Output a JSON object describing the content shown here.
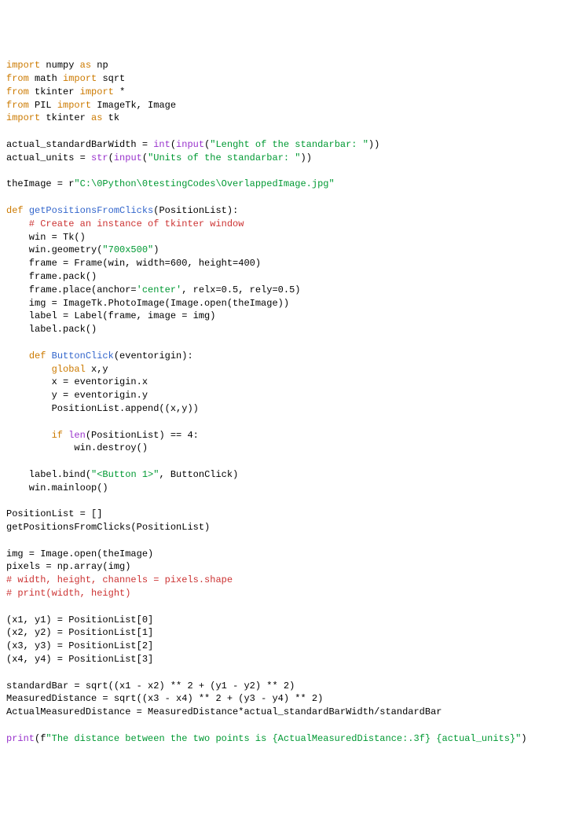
{
  "code": {
    "line1": {
      "kw1": "import",
      "sp1": " ",
      "mod": "numpy",
      "sp2": " ",
      "kw2": "as",
      "sp3": " ",
      "alias": "np"
    },
    "line2": {
      "kw1": "from",
      "sp1": " ",
      "mod": "math",
      "sp2": " ",
      "kw2": "import",
      "sp3": " ",
      "sym": "sqrt"
    },
    "line3": {
      "kw1": "from",
      "sp1": " ",
      "mod": "tkinter",
      "sp2": " ",
      "kw2": "import",
      "sp3": " ",
      "sym": "*"
    },
    "line4": {
      "kw1": "from",
      "sp1": " ",
      "mod": "PIL",
      "sp2": " ",
      "kw2": "import",
      "sp3": " ",
      "sym": "ImageTk, Image"
    },
    "line5": {
      "kw1": "import",
      "sp1": " ",
      "mod": "tkinter",
      "sp2": " ",
      "kw2": "as",
      "sp3": " ",
      "alias": "tk"
    },
    "line7a": "actual_standardBarWidth = ",
    "line7b": "int",
    "line7c": "(",
    "line7d": "input",
    "line7e": "(",
    "line7f": "\"Lenght of the standarbar: \"",
    "line7g": "))",
    "line8a": "actual_units = ",
    "line8b": "str",
    "line8c": "(",
    "line8d": "input",
    "line8e": "(",
    "line8f": "\"Units of the standarbar: \"",
    "line8g": "))",
    "line10a": "theImage = r",
    "line10b": "\"C:\\0Python\\0testingCodes\\OverlappedImage.jpg\"",
    "line12a": "def",
    "line12b": " ",
    "line12c": "getPositionsFromClicks",
    "line12d": "(PositionList):",
    "line13": "    # Create an instance of tkinter window",
    "line14": "    win = Tk()",
    "line15a": "    win.geometry(",
    "line15b": "\"700x500\"",
    "line15c": ")",
    "line16": "    frame = Frame(win, width=600, height=400)",
    "line17": "    frame.pack()",
    "line18a": "    frame.place(anchor=",
    "line18b": "'center'",
    "line18c": ", relx=0.5, rely=0.5)",
    "line19": "    img = ImageTk.PhotoImage(Image.open(theImage))",
    "line20": "    label = Label(frame, image = img)",
    "line21": "    label.pack()",
    "line23a": "    ",
    "line23b": "def",
    "line23c": " ",
    "line23d": "ButtonClick",
    "line23e": "(eventorigin):",
    "line24a": "        ",
    "line24b": "global",
    "line24c": " x,y",
    "line25": "        x = eventorigin.x",
    "line26": "        y = eventorigin.y",
    "line27": "        PositionList.append((x,y))",
    "line29a": "        ",
    "line29b": "if",
    "line29c": " ",
    "line29d": "len",
    "line29e": "(PositionList) == 4:",
    "line30": "            win.destroy()",
    "line32a": "    label.bind(",
    "line32b": "\"<Button 1>\"",
    "line32c": ", ButtonClick)",
    "line33": "    win.mainloop()",
    "line35": "PositionList = []",
    "line36": "getPositionsFromClicks(PositionList)",
    "line38": "img = Image.open(theImage)",
    "line39": "pixels = np.array(img)",
    "line40": "# width, height, channels = pixels.shape",
    "line41": "# print(width, height)",
    "line43": "(x1, y1) = PositionList[0]",
    "line44": "(x2, y2) = PositionList[1]",
    "line45": "(x3, y3) = PositionList[2]",
    "line46": "(x4, y4) = PositionList[3]",
    "line48a": "standardBar = ",
    "line48b": "sqrt",
    "line48c": "((x1 - x2) ** 2 + (y1 - y2) ** 2)",
    "line49a": "MeasuredDistance = ",
    "line49b": "sqrt",
    "line49c": "((x3 - x4) ** 2 + (y3 - y4) ** 2)",
    "line50": "ActualMeasuredDistance = MeasuredDistance*actual_standardBarWidth/standardBar",
    "line52a": "print",
    "line52b": "(f",
    "line52c": "\"The distance between the two points is {ActualMeasuredDistance:.3f} {actual_units}\"",
    "line52d": ")"
  }
}
